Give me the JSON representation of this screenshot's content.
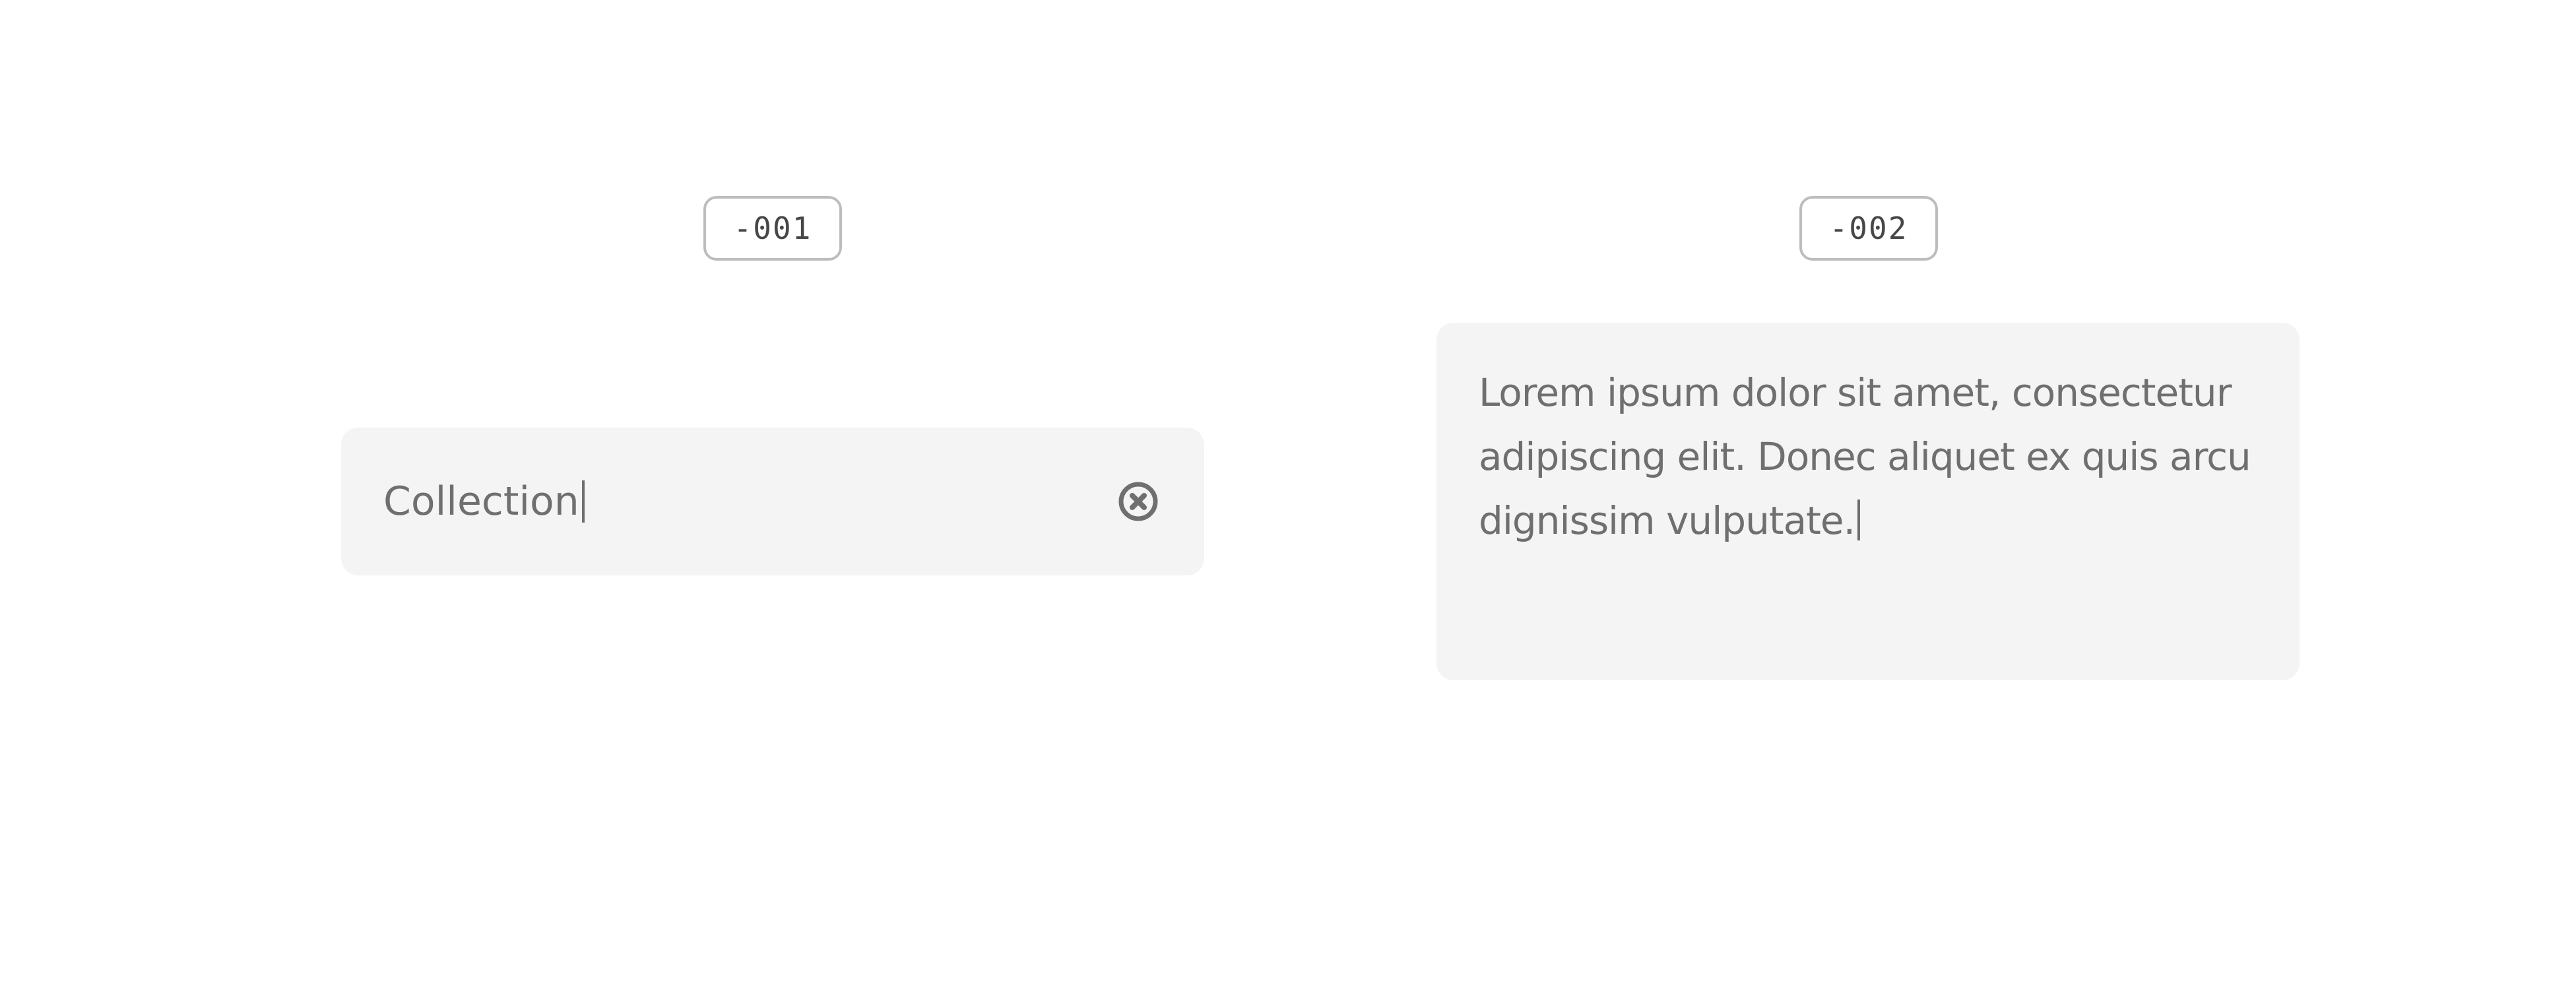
{
  "variants": [
    {
      "tag": "-001"
    },
    {
      "tag": "-002"
    }
  ],
  "search_field": {
    "value": "Collection",
    "clear_icon": "circle-x-icon"
  },
  "text_area": {
    "value": "Lorem ipsum dolor sit amet, consectetur adipiscing elit. Donec aliquet ex quis arcu dignissim vulputate."
  },
  "colors": {
    "field_background": "#f4f4f4",
    "text": "#6f6f6f",
    "tag_border": "#bdbdbd"
  }
}
